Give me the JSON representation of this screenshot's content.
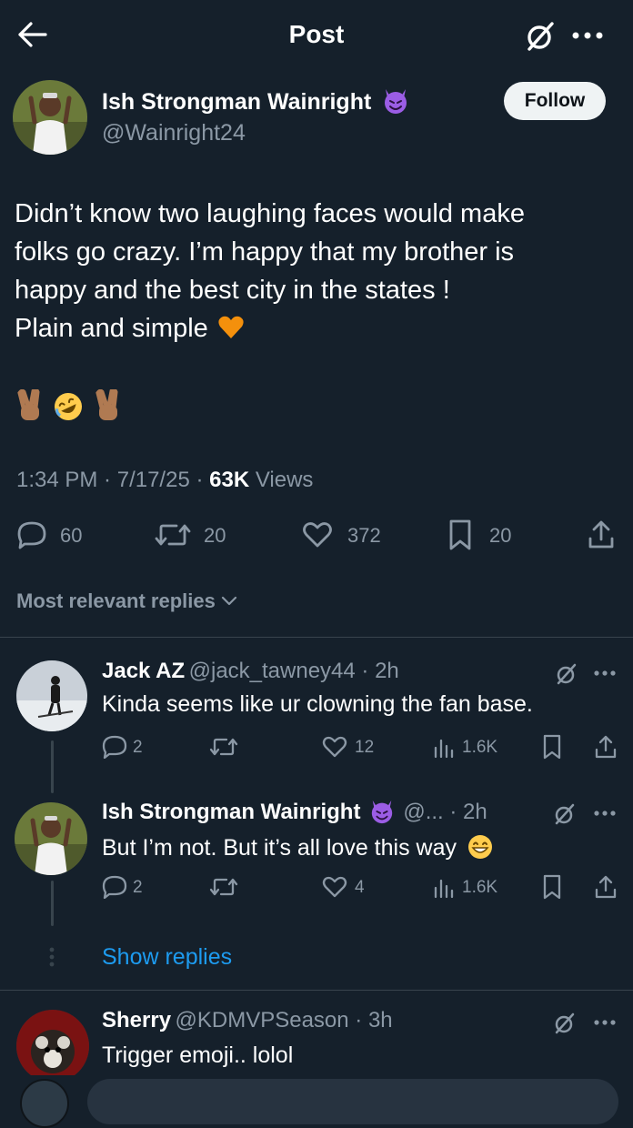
{
  "header": {
    "title": "Post"
  },
  "post": {
    "author_name": "Ish Strongman Wainright",
    "author_handle": "@Wainright24",
    "follow_label": "Follow",
    "text_lines": [
      "Didn’t know two laughing faces would make",
      "folks go crazy. I’m happy that my brother is",
      "happy and the best city in the states !",
      "Plain and simple"
    ],
    "time": "1:34 PM",
    "date": "7/17/25",
    "views_count": "63K",
    "views_label": "Views",
    "replies": "60",
    "reposts": "20",
    "likes": "372",
    "bookmarks": "20"
  },
  "filter": {
    "label": "Most relevant replies"
  },
  "replies": [
    {
      "name": "Jack AZ",
      "meta": "@jack_tawney44 · 2h",
      "text": "Kinda seems like ur clowning the fan base.",
      "replies": "2",
      "likes": "12",
      "views": "1.6K"
    },
    {
      "name": "Ish Strongman Wainright",
      "meta": "@... · 2h",
      "text": "But I’m not. But it’s all love this way",
      "replies": "2",
      "likes": "4",
      "views": "1.6K"
    },
    {
      "name": "Sherry",
      "meta": "@KDMVPSeason · 3h",
      "text": "Trigger emoji.. lolol"
    }
  ],
  "show_replies_label": "Show replies",
  "colors": {
    "background": "#15202b",
    "secondary_text": "#8b98a5",
    "accent": "#1d9bf0",
    "divider": "#38444d",
    "heart_emoji": "#f4900c"
  },
  "icons": [
    "back-arrow-icon",
    "grok-icon",
    "more-icon",
    "devil-emoji-icon",
    "orange-heart-emoji",
    "victory-hand-emoji",
    "rofl-emoji",
    "reply-icon",
    "repost-icon",
    "like-icon",
    "bookmark-icon",
    "share-icon",
    "chevron-down-icon",
    "views-icon",
    "grin-emoji"
  ]
}
